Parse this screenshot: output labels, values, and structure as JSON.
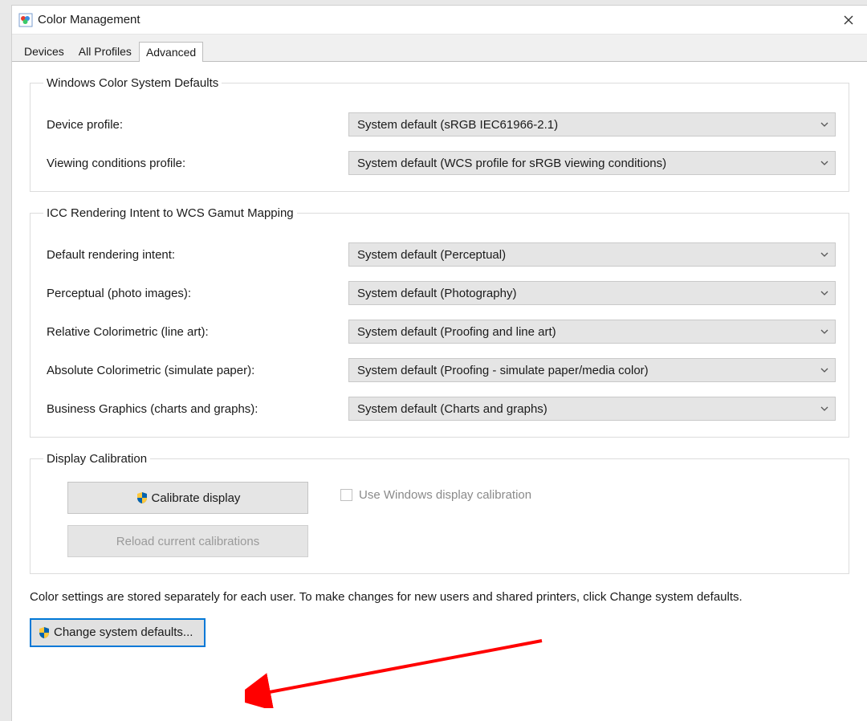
{
  "window": {
    "title": "Color Management"
  },
  "tabs": [
    {
      "label": "Devices",
      "active": false
    },
    {
      "label": "All Profiles",
      "active": false
    },
    {
      "label": "Advanced",
      "active": true
    }
  ],
  "groups": {
    "wcs_defaults": {
      "legend": "Windows Color System Defaults",
      "rows": [
        {
          "label": "Device profile:",
          "value": "System default (sRGB IEC61966-2.1)"
        },
        {
          "label": "Viewing conditions profile:",
          "value": "System default (WCS profile for sRGB viewing conditions)"
        }
      ]
    },
    "icc_mapping": {
      "legend": "ICC Rendering Intent to WCS Gamut Mapping",
      "rows": [
        {
          "label": "Default rendering intent:",
          "value": "System default (Perceptual)"
        },
        {
          "label": "Perceptual (photo images):",
          "value": "System default (Photography)"
        },
        {
          "label": "Relative Colorimetric (line art):",
          "value": "System default (Proofing and line art)"
        },
        {
          "label": "Absolute Colorimetric (simulate paper):",
          "value": "System default (Proofing - simulate paper/media color)"
        },
        {
          "label": "Business Graphics (charts and graphs):",
          "value": "System default (Charts and graphs)"
        }
      ]
    },
    "display_calibration": {
      "legend": "Display Calibration",
      "calibrate_button": "Calibrate display",
      "reload_button": "Reload current calibrations",
      "use_windows_checkbox": "Use Windows display calibration"
    }
  },
  "footer": {
    "note": "Color settings are stored separately for each user. To make changes for new users and shared printers, click Change system defaults.",
    "change_defaults_button": "Change system defaults..."
  }
}
